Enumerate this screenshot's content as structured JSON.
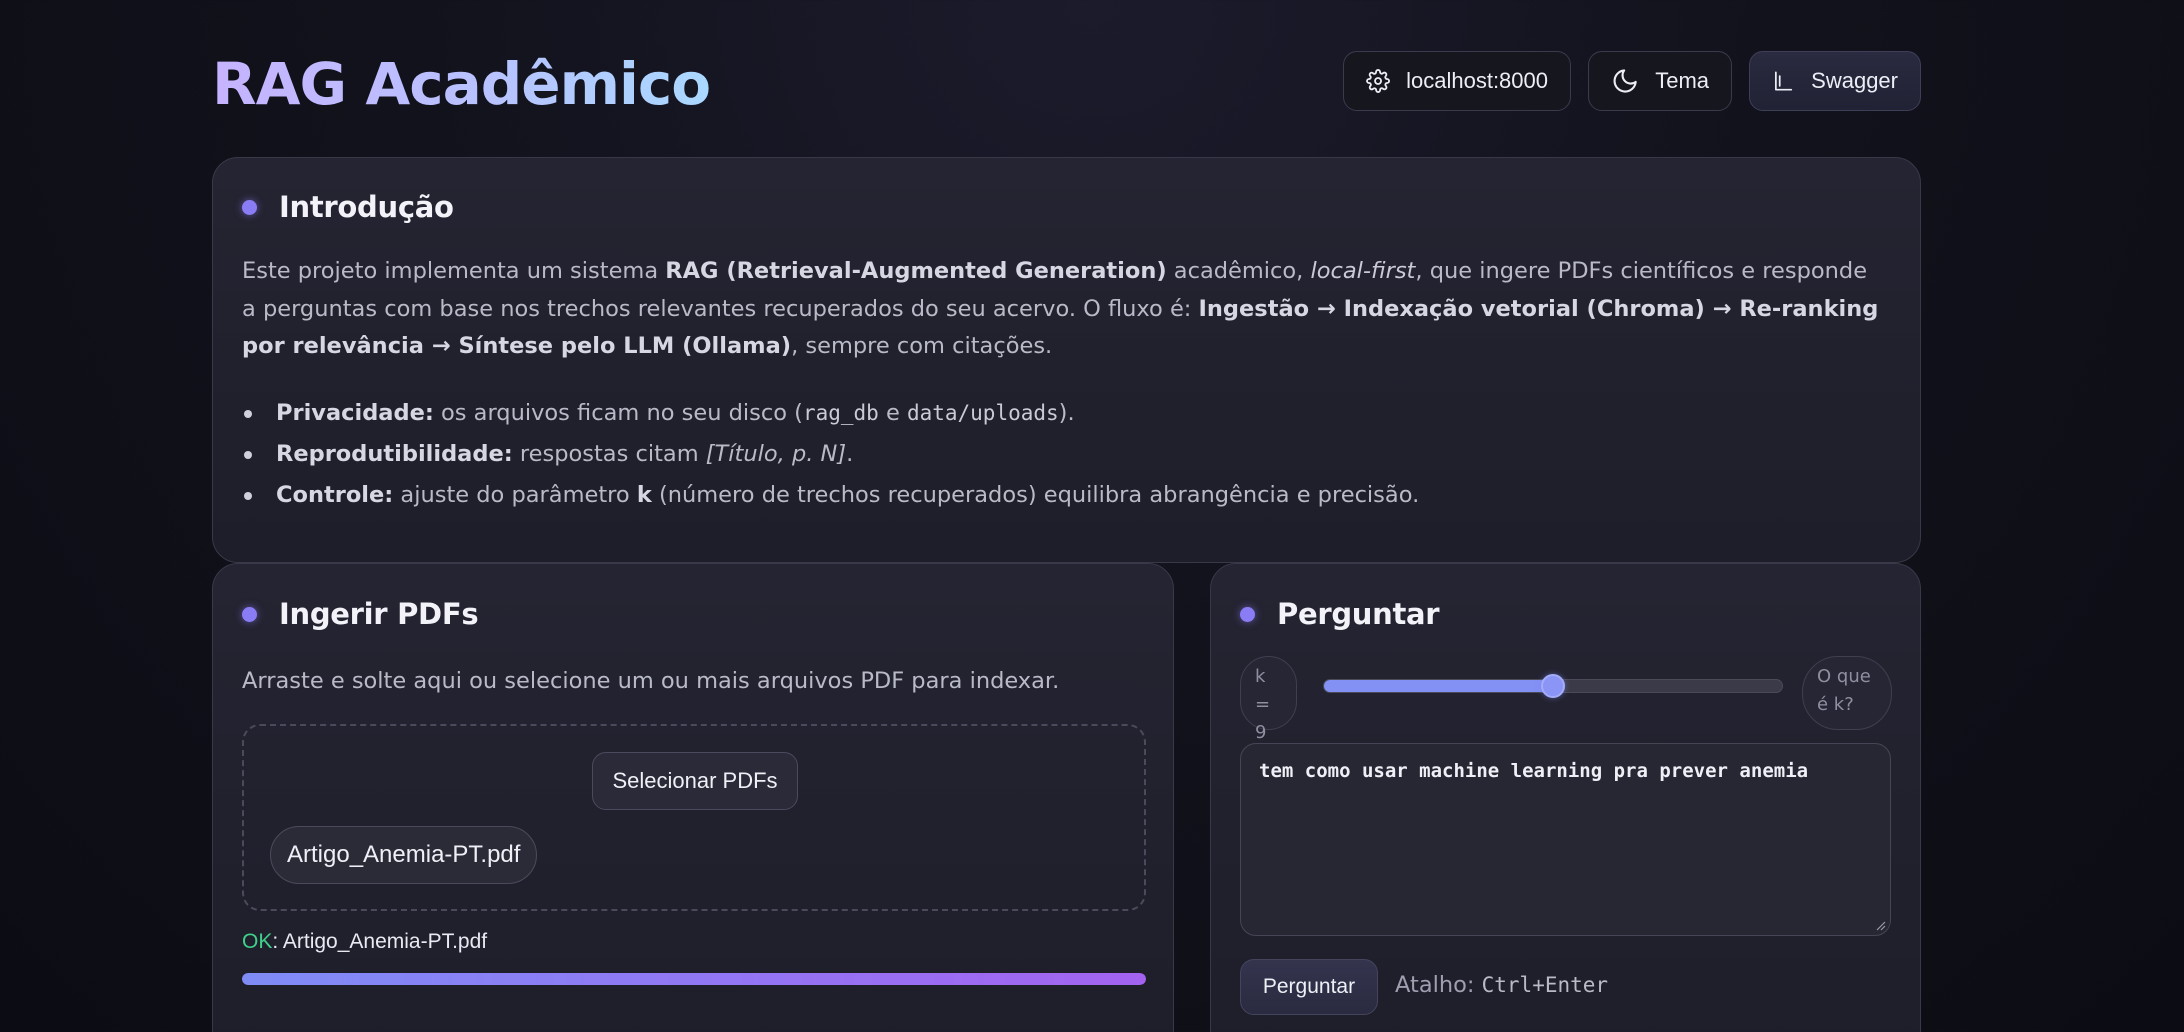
{
  "app": {
    "title": "RAG Acadêmico"
  },
  "toolbar": {
    "server_label": "localhost:8000",
    "theme_label": "Tema",
    "swagger_label": "Swagger"
  },
  "intro": {
    "heading": "Introdução",
    "p1_prefix": "Este projeto implementa um sistema ",
    "p1_bold": "RAG (Retrieval-Augmented Generation)",
    "p1_mid": " acadêmico, ",
    "p1_italic": "local-first",
    "p1_rest": ", que ingere PDFs científicos e responde a perguntas com base nos trechos relevantes recuperados do seu acervo. O fluxo é: ",
    "p1_flow": "Ingestão → Indexação vetorial (Chroma) → Re-ranking por relevância → Síntese pelo LLM (Ollama)",
    "p1_end": ", sempre com citações.",
    "bullets": [
      {
        "label": "Privacidade:",
        "t1": " os arquivos ficam no seu disco (",
        "c1": "rag_db",
        "t2": " e ",
        "c2": "data/uploads",
        "t3": ")."
      },
      {
        "label": "Reprodutibilidade:",
        "t1": " respostas citam ",
        "italic": "[Título, p. N]",
        "t2": "."
      },
      {
        "label": "Controle:",
        "t1": " ajuste do parâmetro ",
        "k": "k",
        "t2": " (número de trechos recuperados) equilibra abrangência e precisão."
      }
    ]
  },
  "ingest": {
    "heading": "Ingerir PDFs",
    "description": "Arraste e solte aqui ou selecione um ou mais arquivos PDF para indexar.",
    "select_button": "Selecionar PDFs",
    "files": [
      "Artigo_Anemia-PT.pdf"
    ],
    "status_ok": "OK",
    "status_file": ": Artigo_Anemia-PT.pdf",
    "progress": 1.0
  },
  "ask": {
    "heading": "Perguntar",
    "k_label": "k = 9",
    "k_value": 9,
    "k_fraction": 0.5,
    "help_label": "O que é k?",
    "question": "tem como usar machine learning pra prever anemia",
    "ask_button": "Perguntar",
    "shortcut_label": "Atalho:",
    "shortcut_keys": "Ctrl+Enter"
  },
  "colors": {
    "accent_dot": "#8a7cf5",
    "ok_green": "#3fd08a",
    "progress_start": "#7f8cf6",
    "progress_end": "#a363f0"
  },
  "icons": {
    "server": "gear-icon",
    "theme": "moon-icon",
    "swagger": "chart-axes-icon"
  }
}
